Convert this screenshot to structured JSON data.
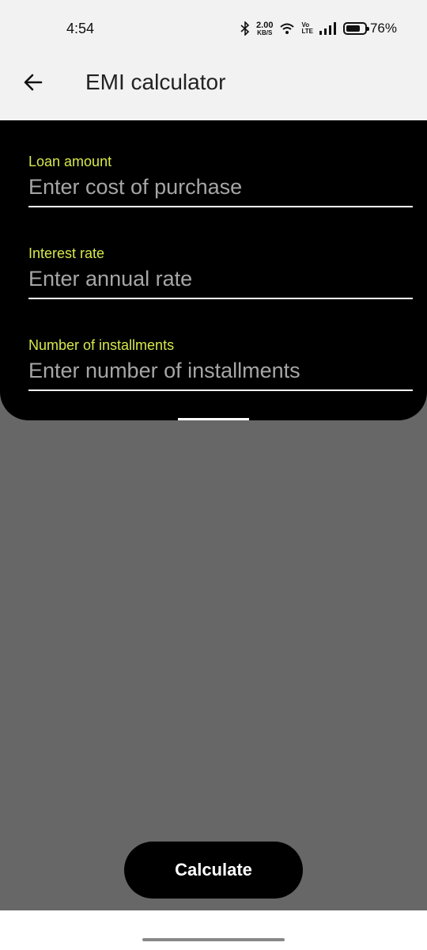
{
  "status_bar": {
    "time": "4:54",
    "net_speed_value": "2.00",
    "net_speed_unit": "KB/S",
    "volte_top": "Vo",
    "volte_bottom": "LTE",
    "battery_percent": "76%",
    "battery_level": 0.76,
    "icons": [
      "bluetooth-icon",
      "wifi-icon",
      "volte-icon",
      "signal-icon",
      "battery-icon"
    ]
  },
  "app_bar": {
    "back_icon": "arrow-left-icon",
    "title": "EMI calculator"
  },
  "form": {
    "fields": [
      {
        "label": "Loan amount",
        "placeholder": "Enter cost of purchase",
        "value": ""
      },
      {
        "label": "Interest rate",
        "placeholder": "Enter annual rate",
        "value": ""
      },
      {
        "label": "Number of installments",
        "placeholder": "Enter number of installments",
        "value": ""
      }
    ]
  },
  "actions": {
    "calculate_label": "Calculate"
  },
  "colors": {
    "accent_label": "#d7e84a",
    "card_background": "#000000",
    "scrim": "#676767",
    "app_bar_background": "#f2f2f2"
  }
}
